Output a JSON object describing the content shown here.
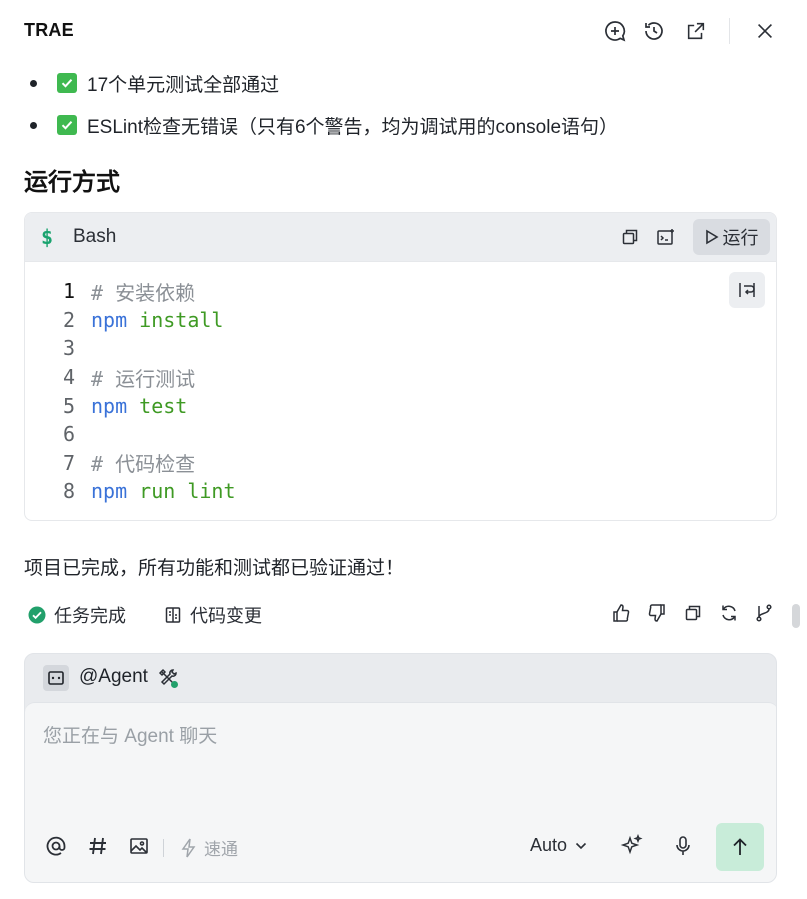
{
  "header": {
    "title": "TRAE",
    "icons": [
      "new-chat-icon",
      "history-icon",
      "open-external-icon",
      "close-icon"
    ]
  },
  "summary": {
    "items": [
      {
        "icon": "check-icon",
        "text": "17个单元测试全部通过"
      },
      {
        "icon": "check-icon",
        "text": "ESLint检查无错误（只有6个警告，均为调试用的console语句）"
      }
    ]
  },
  "section": {
    "title": "运行方式"
  },
  "code_block": {
    "language": "Bash",
    "prompt_symbol": "$",
    "run_label": "运行",
    "lines": [
      {
        "num": "1",
        "text": "# 安装依赖"
      },
      {
        "num": "2",
        "text": "npm install"
      },
      {
        "num": "3",
        "text": ""
      },
      {
        "num": "4",
        "text": "# 运行测试"
      },
      {
        "num": "5",
        "text": "npm test"
      },
      {
        "num": "6",
        "text": ""
      },
      {
        "num": "7",
        "text": "# 代码检查"
      },
      {
        "num": "8",
        "text": "npm run lint"
      }
    ]
  },
  "message": {
    "text": "项目已完成，所有功能和测试都已验证通过！"
  },
  "status": {
    "task_done": "任务完成",
    "code_changes": "代码变更"
  },
  "composer": {
    "agent_label": "@Agent",
    "placeholder": "您正在与 Agent 聊天",
    "speed_label": "速通",
    "model": "Auto",
    "colors": {
      "send_bg": "#c8ecd9",
      "accent": "#1aa36f"
    }
  }
}
